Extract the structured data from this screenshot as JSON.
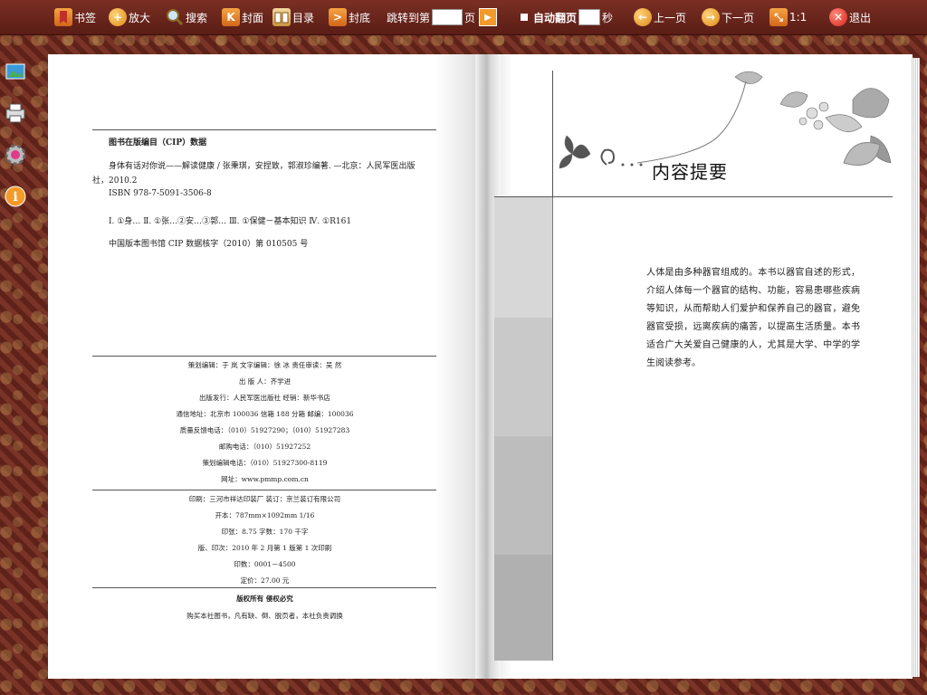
{
  "toolbar": {
    "bookmark": "书签",
    "zoom": "放大",
    "search": "搜索",
    "cover": "封面",
    "toc": "目录",
    "back_cover": "封底",
    "goto_label": "跳转到第",
    "goto_unit": "页",
    "auto_flip": "自动翻页",
    "seconds": "秒",
    "prev": "上一页",
    "next": "下一页",
    "ratio": "1:1",
    "exit": "退出"
  },
  "left_page": {
    "cip_title": "图书在版编目（CIP）数据",
    "cip_line1": "身体有话对你说——解读健康 / 张秉琪，安捏致，郭淑珍编著. —北京：人民军医出版",
    "cip_line2": "社，2010.2",
    "isbn": "ISBN 978-7-5091-3506-8",
    "classification": "Ⅰ. ①身…   Ⅱ. ①张…②安…③郭…   Ⅲ. ①保健－基本知识   Ⅳ. ①R161",
    "cip_number": "中国版本图书馆 CIP 数据核字（2010）第 010505 号",
    "credits": [
      "策划编辑：于   岚          文字编辑：徐   冰          责任审读：吴   然",
      "出 版 人：齐学进",
      "出版发行：人民军医出版社                            经销：新华书店",
      "通信地址：北京市 100036 信箱 188 分箱          邮编：100036",
      "质量反馈电话：（010）51927290；（010）51927283",
      "邮购电话：（010）51927252",
      "策划编辑电话：（010）51927300-8119",
      "网址：www.pmmp.com.cn"
    ],
    "printing": [
      "印刷：三河市祥达印装厂          装订：京兰装订有限公司",
      "开本：787mm×1092mm          1/16",
      "印张：8.75          字数：170 千字",
      "版、印次：2010 年 2 月第 1 版第 1 次印刷",
      "印数：0001－4500",
      "定价：27.00 元"
    ],
    "rights": "版权所有   侵权必究",
    "rights_note": "购买本社图书，凡有缺、倒、脱页者，本社负责调换"
  },
  "right_page": {
    "heading": "内容提要",
    "summary": "人体是由多种器官组成的。本书以器官自述的形式，介绍人体每一个器官的结构、功能，容易患哪些疾病等知识，从而帮助人们爱护和保养自己的器官，避免器官受损，远离疾病的痛苦，以提高生活质量。本书适合广大关爱自己健康的人，尤其是大学、中学的学生阅读参考。"
  },
  "colors": {
    "toolbar": "#6b2418",
    "icon_orange": "#e8841f",
    "exit_red": "#d9231a"
  }
}
